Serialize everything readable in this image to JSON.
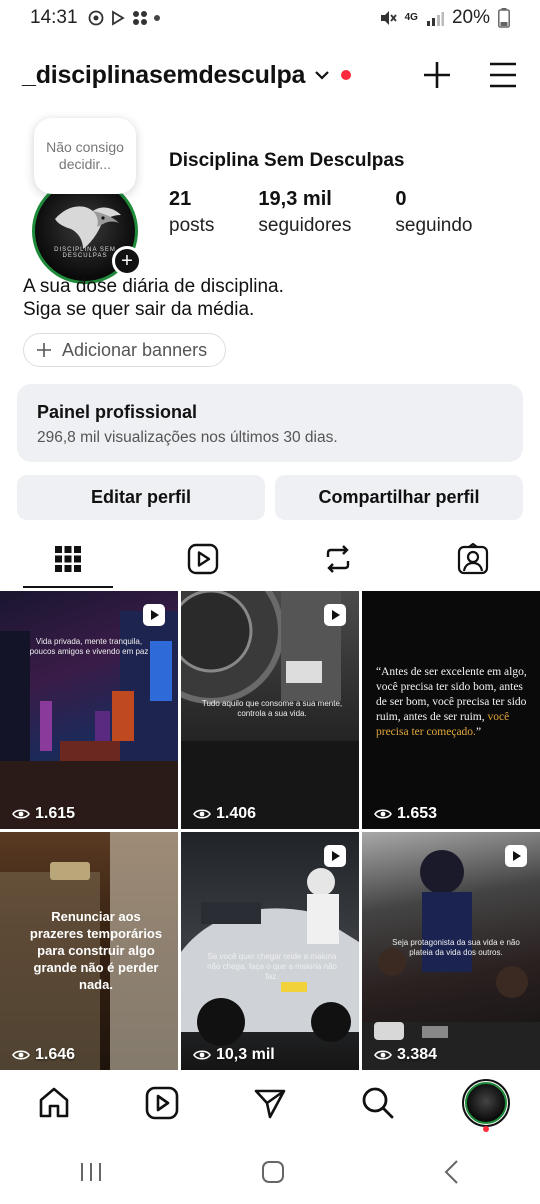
{
  "status_bar": {
    "time": "14:31",
    "network": "4G",
    "battery": "20%"
  },
  "header": {
    "username": "_disciplinasemdesculpa"
  },
  "note": {
    "text": "Não consigo decidir..."
  },
  "profile": {
    "display_name": "Disciplina Sem Desculpas",
    "avatar_text": "DISCIPLINA SEM DESCULPAS",
    "stats": [
      {
        "value": "21",
        "label": "posts"
      },
      {
        "value": "19,3 mil",
        "label": "seguidores"
      },
      {
        "value": "0",
        "label": "seguindo"
      }
    ],
    "bio_line1": "A sua dose diária de disciplina.",
    "bio_line2": "Siga se quer sair da média.",
    "banner_button": "Adicionar banners"
  },
  "pro_panel": {
    "title": "Painel profissional",
    "subtitle": "296,8 mil visualizações nos últimos 30 dias."
  },
  "actions": {
    "edit": "Editar perfil",
    "share": "Compartilhar perfil"
  },
  "tabs": [
    "grid-icon",
    "reels-icon",
    "reposts-icon",
    "tagged-icon"
  ],
  "posts": [
    {
      "views": "1.615",
      "caption": "Vida privada, mente tranquila, poucos amigos e vivendo em paz"
    },
    {
      "views": "1.406",
      "caption": "Tudo aquilo que consome a sua mente, controla a sua vida."
    },
    {
      "views": "1.653",
      "quote_main": "“Antes de ser excelente em algo, você precisa ter sido bom, antes de ser bom, você precisa ter sido ruim, antes de ser ruim, ",
      "quote_highlight": "você precisa ter começado.",
      "quote_end": "”"
    },
    {
      "views": "1.646",
      "quote": "Renunciar aos prazeres temporários para construir algo grande não é perder nada."
    },
    {
      "views": "10,3 mil",
      "caption": "Se você quer chegar onde a maioria não chega, faça o que a maioria não faz."
    },
    {
      "views": "3.384",
      "caption": "Seja protagonista da sua vida e não plateia da vida dos outros."
    }
  ],
  "bottom_nav": [
    "home-icon",
    "reels-icon",
    "send-icon",
    "search-icon",
    "profile-avatar"
  ]
}
